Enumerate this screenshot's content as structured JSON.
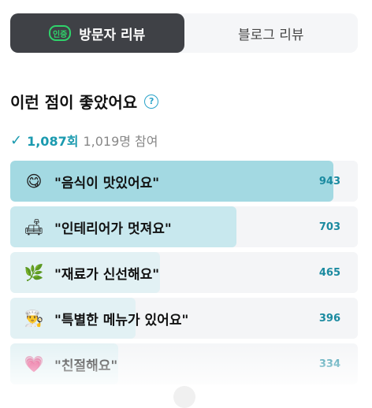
{
  "tabs": [
    {
      "label": "방문자 리뷰",
      "badge": "인증",
      "active": true
    },
    {
      "label": "블로그 리뷰",
      "active": false
    }
  ],
  "section": {
    "title": "이런 점이 좋았어요",
    "help_icon": "question-circle-icon"
  },
  "stats": {
    "count": "1,087회",
    "participants": "1,019명 참여"
  },
  "items": [
    {
      "label": "\"음식이 맛있어요\"",
      "count": "943",
      "icon": "tasty-face-emoji",
      "level": 0.93
    },
    {
      "label": "\"인테리어가 멋져요\"",
      "count": "703",
      "icon": "sofa-emoji",
      "level": 0.65
    },
    {
      "label": "\"재료가 신선해요\"",
      "count": "465",
      "icon": "leaf-emoji",
      "level": 0.43
    },
    {
      "label": "\"특별한 메뉴가 있어요\"",
      "count": "396",
      "icon": "chef-emoji",
      "level": 0.36
    },
    {
      "label": "\"친절해요\"",
      "count": "334",
      "icon": "heart-emoji",
      "level": 0.31
    }
  ],
  "colors": {
    "fill_top": "#a3d9e2",
    "fill_mid": "#c8e8ee",
    "fill_low": "#e2f1f4",
    "accent": "#1a9aaf"
  }
}
